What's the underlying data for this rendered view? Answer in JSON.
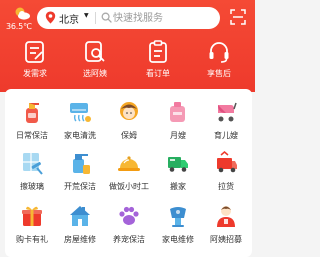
{
  "header": {
    "temperature": "36.5℃",
    "city": "北京",
    "search_placeholder": "快速找服务",
    "quick_actions": [
      {
        "label": "发需求"
      },
      {
        "label": "选阿姨"
      },
      {
        "label": "看订单"
      },
      {
        "label": "享售后"
      }
    ]
  },
  "services": [
    {
      "label": "日常保洁",
      "icon": "cleaning-spray-icon"
    },
    {
      "label": "家电清洗",
      "icon": "appliance-wash-icon"
    },
    {
      "label": "保姆",
      "icon": "nanny-icon"
    },
    {
      "label": "月嫂",
      "icon": "maternity-nurse-icon"
    },
    {
      "label": "育儿嫂",
      "icon": "stroller-icon"
    },
    {
      "label": "擦玻璃",
      "icon": "squeegee-icon"
    },
    {
      "label": "开荒保洁",
      "icon": "cleaning-bottle-icon"
    },
    {
      "label": "做饭小时工",
      "icon": "cloche-icon"
    },
    {
      "label": "搬家",
      "icon": "truck-icon"
    },
    {
      "label": "拉货",
      "icon": "cargo-icon"
    },
    {
      "label": "购卡有礼",
      "icon": "gift-icon"
    },
    {
      "label": "房屋维修",
      "icon": "house-repair-icon"
    },
    {
      "label": "养宠保洁",
      "icon": "paw-icon"
    },
    {
      "label": "家电维修",
      "icon": "appliance-repair-icon"
    },
    {
      "label": "阿姨招募",
      "icon": "recruit-icon"
    }
  ],
  "colors": {
    "brand_red": "#ee3a2c",
    "sun": "#f7b733"
  }
}
